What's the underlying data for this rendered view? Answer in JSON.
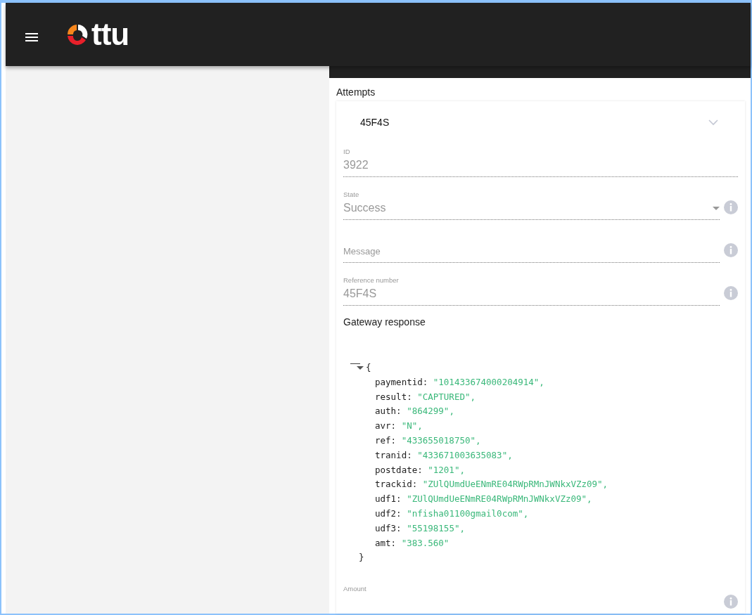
{
  "header": {
    "logo_text": "ttu"
  },
  "attempts": {
    "title": "Attempts",
    "panel": {
      "title": "45F4S",
      "expanded": true,
      "fields": [
        {
          "kind": "text",
          "label": "ID",
          "value": "3922",
          "info": false
        },
        {
          "kind": "select",
          "label": "State",
          "value": "Success",
          "info": true
        },
        {
          "kind": "text",
          "placeholder": "Message",
          "info": true
        },
        {
          "kind": "text",
          "label": "Reference number",
          "value": "45F4S",
          "info": true
        },
        {
          "kind": "json",
          "label": "Gateway response",
          "expanded": true,
          "open_brace": "{",
          "close_brace": "}",
          "entries": [
            {
              "key": "paymentid:",
              "value": "\"101433674000204914\","
            },
            {
              "key": "result:",
              "value": "\"CAPTURED\","
            },
            {
              "key": "auth:",
              "value": "\"864299\","
            },
            {
              "key": "avr:",
              "value": "\"N\","
            },
            {
              "key": "ref:",
              "value": "\"433655018750\","
            },
            {
              "key": "tranid:",
              "value": "\"433671003635083\","
            },
            {
              "key": "postdate:",
              "value": "\"1201\","
            },
            {
              "key": "trackid:",
              "value": "\"ZUlQUmdUeENmRE04RWpRMnJWNkxVZz09\","
            },
            {
              "key": "udf1:",
              "value": "\"ZUlQUmdUeENmRE04RWpRMnJWNkxVZz09\","
            },
            {
              "key": "udf2:",
              "value": "\"nfisha01100gmail0com\","
            },
            {
              "key": "udf3:",
              "value": "\"55198155\","
            },
            {
              "key": "amt:",
              "value": "\"383.560\""
            }
          ]
        },
        {
          "kind": "text",
          "label": "Amount",
          "info": true
        }
      ]
    }
  }
}
